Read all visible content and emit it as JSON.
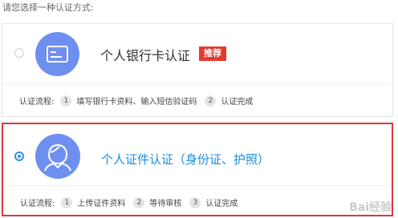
{
  "prompt": "请您选择一种认证方式:",
  "options": [
    {
      "title": "个人银行卡认证",
      "badge": "推荐",
      "icon": "bank-card-icon",
      "flow_label": "认证流程:",
      "steps": [
        {
          "num": "1",
          "label": "填写银行卡资料、输入短信验证码"
        },
        {
          "num": "2",
          "label": "认证完成"
        }
      ],
      "selected": false
    },
    {
      "title": "个人证件认证（身份证、护照）",
      "icon": "person-icon",
      "flow_label": "认证流程:",
      "steps": [
        {
          "num": "1",
          "label": "上传证件资料"
        },
        {
          "num": "2",
          "label": "等待审核"
        },
        {
          "num": "3",
          "label": "认证完成"
        }
      ],
      "selected": true
    }
  ],
  "colors": {
    "accent": "#1b8be0",
    "badge": "#e33a2f",
    "icon_bg": "#6f8ff0",
    "selected_border": "#d93a3a"
  },
  "watermark": "Bai经验"
}
